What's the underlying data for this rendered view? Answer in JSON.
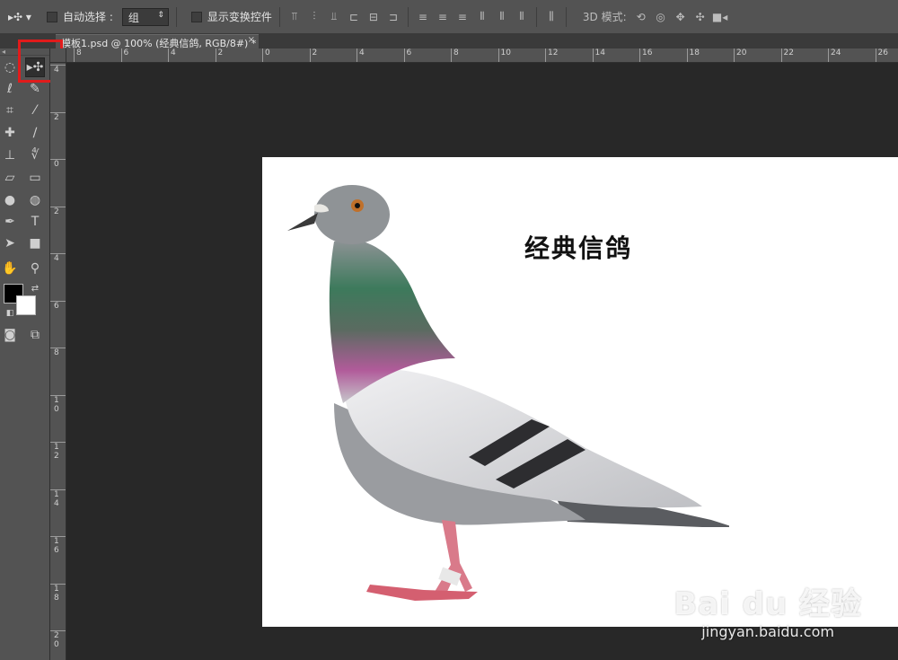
{
  "options_bar": {
    "auto_select_label": "自动选择 :",
    "auto_select_value": "组",
    "show_transform_label": "显示变换控件",
    "mode_3d_label": "3D 模式:"
  },
  "document_tab": {
    "title": "模板1.psd @ 100% (经典信鸽, RGB/8#) *",
    "close": "×"
  },
  "ruler": {
    "top_labels": [
      "8",
      "6",
      "4",
      "2",
      "0",
      "2",
      "4",
      "6",
      "8",
      "10",
      "12",
      "14",
      "16",
      "18",
      "20",
      "22",
      "24",
      "26"
    ],
    "left_labels": [
      "4",
      "2",
      "0",
      "2",
      "4",
      "6",
      "8",
      "1\n0",
      "1\n2",
      "1\n4",
      "1\n6",
      "1\n8",
      "2\n0"
    ]
  },
  "canvas": {
    "title": "经典信鸽"
  },
  "watermark": {
    "logo": "Bai du 经验",
    "url": "jingyan.baidu.com"
  },
  "colors": {
    "highlight": "#e11b1b",
    "foreground": "#000000",
    "background": "#ffffff"
  },
  "toolbox": {
    "tools": [
      "marquee-icon",
      "move-icon",
      "lasso-icon",
      "quick-select-icon",
      "crop-icon",
      "eyedropper-icon",
      "healing-brush-icon",
      "brush-icon",
      "clone-stamp-icon",
      "history-brush-icon",
      "eraser-icon",
      "gradient-icon",
      "blur-icon",
      "dodge-icon",
      "pen-icon",
      "type-icon",
      "path-select-icon",
      "rectangle-icon",
      "hand-icon",
      "zoom-icon",
      "quick-mask-icon",
      "screen-mode-icon"
    ]
  }
}
